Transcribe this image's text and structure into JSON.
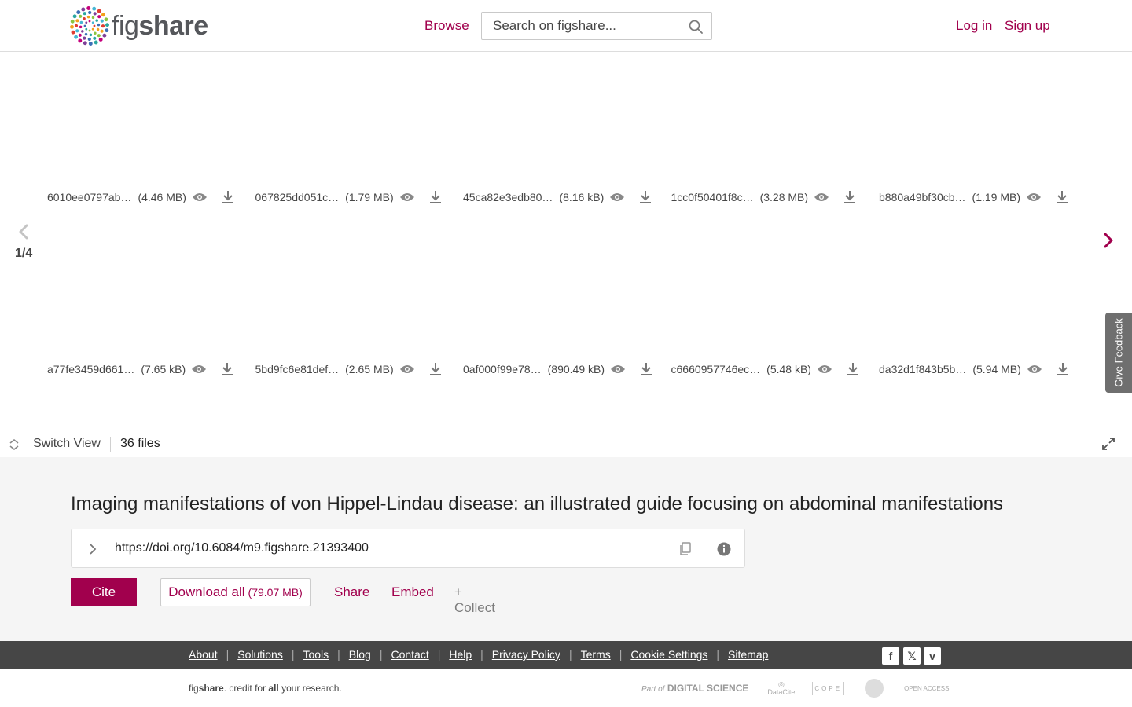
{
  "header": {
    "logo_text_light": "fig",
    "logo_text_bold": "share",
    "browse_label": "Browse",
    "search_placeholder": "Search on figshare...",
    "login_label": "Log in",
    "signup_label": "Sign up"
  },
  "viewer": {
    "rows": [
      [
        {
          "name": "6010ee0797ab…",
          "size": "(4.46 MB)"
        },
        {
          "name": "067825dd051c…",
          "size": "(1.79 MB)"
        },
        {
          "name": "45ca82e3edb80…",
          "size": "(8.16 kB)"
        },
        {
          "name": "1cc0f50401f8c…",
          "size": "(3.28 MB)"
        },
        {
          "name": "b880a49bf30cb…",
          "size": "(1.19 MB)"
        }
      ],
      [
        {
          "name": "a77fe3459d661…",
          "size": "(7.65 kB)"
        },
        {
          "name": "5bd9fc6e81def…",
          "size": "(2.65 MB)"
        },
        {
          "name": "0af000f99e78…",
          "size": "(890.49 kB)"
        },
        {
          "name": "c6660957746ec…",
          "size": "(5.48 kB)"
        },
        {
          "name": "da32d1f843b5b…",
          "size": "(5.94 MB)"
        }
      ]
    ],
    "page_indicator": "1/4",
    "feedback_label": "Give Feedback",
    "switch_view_label": "Switch View",
    "files_count": "36 files"
  },
  "item": {
    "title": "Imaging manifestations of von Hippel-Lindau disease: an illustrated guide focusing on abdominal manifestations",
    "doi": "https://doi.org/10.6084/m9.figshare.21393400",
    "cite_label": "Cite",
    "download_label": "Download all",
    "download_size": "(79.07 MB)",
    "share_label": "Share",
    "embed_label": "Embed",
    "collect_label": "+ Collect"
  },
  "footer": {
    "links": [
      "About",
      "Solutions",
      "Tools",
      "Blog",
      "Contact",
      "Help",
      "Privacy Policy",
      "Terms",
      "Cookie Settings",
      "Sitemap"
    ],
    "social": [
      "facebook-icon",
      "x-icon",
      "vimeo-icon"
    ],
    "tagline": {
      "fig": "fig",
      "share": "share",
      "middle": ". credit for ",
      "all": "all",
      "end": " your research."
    },
    "partners": {
      "part_of": "Part of",
      "digital_science": "DIGITAL SCIENCE",
      "datacite": "DataCite",
      "cope": "COPE",
      "open_access": "OPEN ACCESS"
    }
  },
  "colors": {
    "brand": "#a1004d",
    "footer_bg": "#464646",
    "details_bg": "#f5f5f5"
  }
}
